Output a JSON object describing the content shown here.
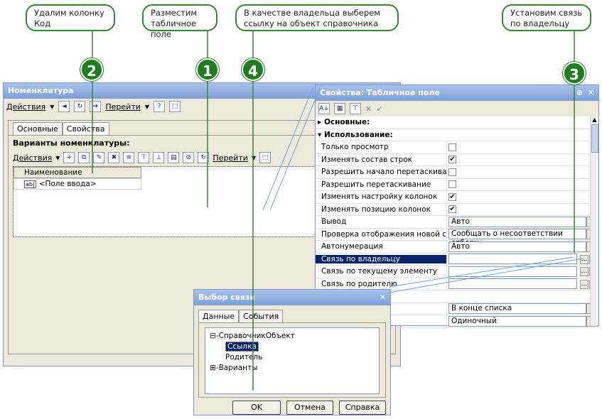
{
  "callouts": {
    "c1": "Удалим колонку\nКод",
    "c2": "Разместим\nтабличное поле",
    "c3": "В качестве владельца выберем\nссылку на объект справочника",
    "c4": "Установим связь\nпо владельцу"
  },
  "markers": [
    "2",
    "1",
    "4",
    "3"
  ],
  "main_window": {
    "title": "Номенклатура",
    "menu": {
      "actions": "Действия",
      "goto": "Перейти"
    },
    "tabs": [
      "Основные",
      "Свойства"
    ],
    "section_title": "Варианты номенклатуры:",
    "inner_actions": "Действия",
    "inner_goto": "Перейти",
    "column_header": "Наименование",
    "cell_value": "<Поле ввода>"
  },
  "props_window": {
    "title": "Свойства: Табличное поле",
    "groups": {
      "basic": "Основные:",
      "usage": "Использование:"
    },
    "rows": [
      {
        "label": "Только просмотр",
        "type": "check",
        "checked": false
      },
      {
        "label": "Изменять состав строк",
        "type": "check",
        "checked": true
      },
      {
        "label": "Разрешить начало перетаскивания",
        "type": "check",
        "checked": false
      },
      {
        "label": "Разрешить перетаскивание",
        "type": "check",
        "checked": false
      },
      {
        "label": "Изменять настройку колонок",
        "type": "check",
        "checked": true
      },
      {
        "label": "Изменять позицию колонок",
        "type": "check",
        "checked": true
      },
      {
        "label": "Вывод",
        "type": "combo",
        "value": "Авто"
      },
      {
        "label": "Проверка отображения новой строки",
        "type": "combo",
        "value": "Сообщать о несоответствии отбору"
      },
      {
        "label": "Автонумерация",
        "type": "combo",
        "value": "Авто"
      },
      {
        "label": "Связь по владельцу",
        "type": "pick",
        "value": "",
        "selected": true
      },
      {
        "label": "Связь по текущему элементу",
        "type": "pick",
        "value": ""
      },
      {
        "label": "Связь по родителю",
        "type": "pick",
        "value": ""
      }
    ],
    "extra_rows": [
      {
        "value": "В конце списка"
      },
      {
        "value": "Одиночный"
      }
    ]
  },
  "dialog": {
    "title": "Выбор связи",
    "tabs": [
      "Данные",
      "События"
    ],
    "tree": {
      "root": "СправочникОбъект",
      "child1": "Ссылка",
      "child2": "Родитель",
      "root2": "Варианты"
    },
    "buttons": {
      "ok": "OK",
      "cancel": "Отмена",
      "help": "Справка"
    }
  }
}
